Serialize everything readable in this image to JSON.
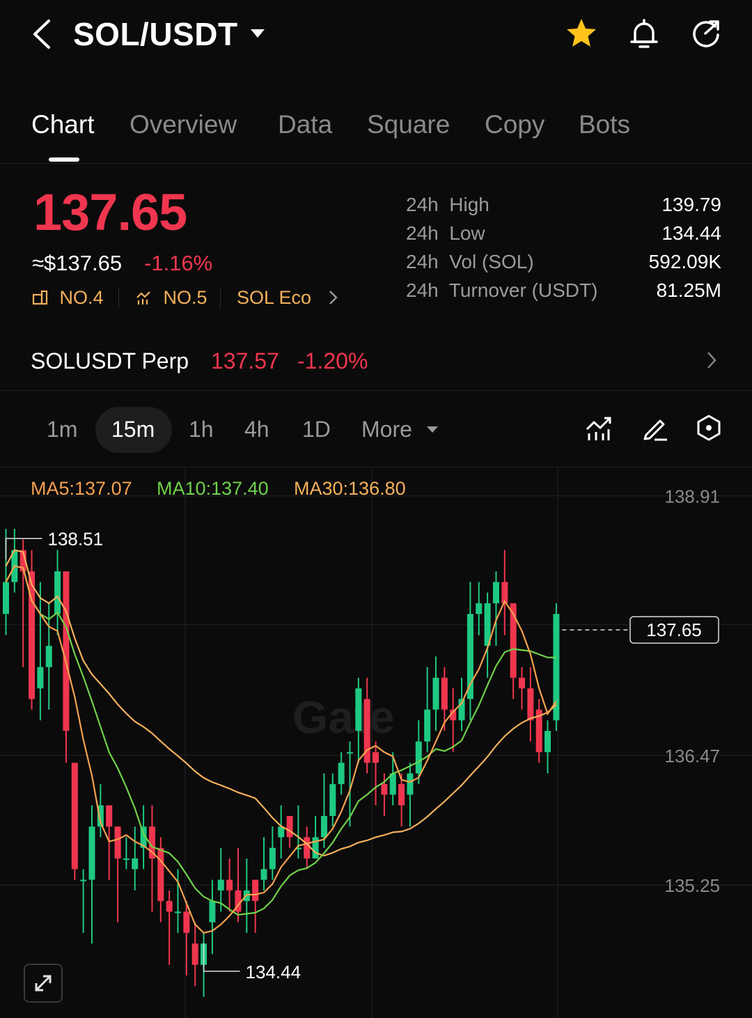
{
  "header": {
    "title": "SOL/USDT",
    "icons": [
      "back-chevron-icon",
      "dropdown-caret-icon",
      "star-icon",
      "bell-icon",
      "share-icon"
    ],
    "star_color": "#ffc31a"
  },
  "tabs": [
    {
      "label": "Chart",
      "active": true
    },
    {
      "label": "Overview"
    },
    {
      "label": "Data"
    },
    {
      "label": "Square"
    },
    {
      "label": "Copy"
    },
    {
      "label": "Bots"
    }
  ],
  "ticker": {
    "last_price": "137.65",
    "fiat_price": "≈$137.65",
    "change_pct": "-1.16%",
    "rank1": "NO.4",
    "rank2": "NO.5",
    "eco": "SOL Eco",
    "stats": [
      {
        "period": "24h",
        "label": "High",
        "value": "139.79"
      },
      {
        "period": "24h",
        "label": "Low",
        "value": "134.44"
      },
      {
        "period": "24h",
        "label": "Vol (SOL)",
        "value": "592.09K"
      },
      {
        "period": "24h",
        "label": "Turnover (USDT)",
        "value": "81.25M"
      }
    ]
  },
  "perp": {
    "name": "SOLUSDT Perp",
    "price": "137.57",
    "change": "-1.20%"
  },
  "intervals": [
    {
      "label": "1m"
    },
    {
      "label": "15m",
      "active": true
    },
    {
      "label": "1h"
    },
    {
      "label": "4h"
    },
    {
      "label": "1D"
    },
    {
      "label": "More"
    }
  ],
  "tools": [
    "indicator-icon",
    "draw-pen-icon",
    "settings-hex-icon"
  ],
  "colors": {
    "up": "#1ec982",
    "down": "#f0364f",
    "ma5": "#f6a14f",
    "ma10": "#6fd24a",
    "ma30": "#f6b15c",
    "accent": "#f6b15c"
  },
  "chart_data": {
    "type": "candlestick",
    "interval": "15m",
    "ma_labels": {
      "ma5": "MA5:137.07",
      "ma10": "MA10:137.40",
      "ma30": "MA30:136.80"
    },
    "y_ticks": [
      "138.91",
      "136.47",
      "135.25"
    ],
    "high_marker": "138.51",
    "low_marker": "134.44",
    "current_price_label": "137.65",
    "ylim": [
      134.0,
      139.17
    ],
    "candles": [
      [
        137.8,
        138.1,
        138.6,
        137.6
      ],
      [
        138.1,
        138.4,
        138.6,
        138.0
      ],
      [
        138.4,
        138.2,
        138.5,
        137.3
      ],
      [
        138.2,
        137.0,
        138.4,
        136.9
      ],
      [
        137.1,
        137.3,
        138.1,
        136.8
      ],
      [
        137.3,
        137.5,
        137.9,
        136.9
      ],
      [
        137.8,
        138.2,
        138.4,
        137.6
      ],
      [
        138.2,
        136.7,
        138.0,
        136.4
      ],
      [
        136.4,
        135.4,
        136.4,
        135.3
      ],
      [
        135.3,
        135.3,
        135.4,
        134.8
      ],
      [
        135.3,
        135.8,
        136.0,
        134.7
      ],
      [
        135.8,
        136.0,
        136.2,
        135.7
      ],
      [
        136.0,
        135.8,
        136.0,
        135.3
      ],
      [
        135.8,
        135.5,
        135.8,
        134.9
      ],
      [
        135.5,
        135.5,
        135.7,
        135.4
      ],
      [
        135.4,
        135.5,
        135.8,
        135.2
      ],
      [
        135.6,
        135.8,
        136.0,
        135.4
      ],
      [
        135.8,
        135.5,
        136.0,
        135.0
      ],
      [
        135.6,
        135.1,
        135.7,
        134.9
      ],
      [
        135.1,
        135.0,
        135.2,
        134.5
      ],
      [
        135.0,
        135.0,
        135.4,
        134.8
      ],
      [
        135.0,
        134.8,
        135.1,
        134.4
      ],
      [
        134.7,
        134.5,
        134.9,
        134.3
      ],
      [
        134.5,
        134.7,
        134.8,
        134.2
      ],
      [
        134.9,
        135.1,
        135.3,
        134.6
      ],
      [
        135.2,
        135.3,
        135.6,
        135.0
      ],
      [
        135.3,
        135.2,
        135.5,
        135.0
      ],
      [
        135.2,
        135.0,
        135.6,
        134.9
      ],
      [
        135.1,
        135.2,
        135.5,
        134.8
      ],
      [
        135.3,
        135.1,
        135.3,
        134.8
      ],
      [
        135.3,
        135.4,
        135.7,
        135.2
      ],
      [
        135.4,
        135.6,
        135.8,
        135.3
      ],
      [
        135.7,
        135.8,
        136.0,
        135.5
      ],
      [
        135.9,
        135.7,
        135.9,
        135.6
      ],
      [
        135.6,
        135.6,
        136.0,
        135.5
      ],
      [
        135.7,
        135.5,
        135.8,
        135.4
      ],
      [
        135.5,
        135.7,
        135.9,
        135.6
      ],
      [
        135.7,
        135.9,
        136.3,
        135.6
      ],
      [
        135.9,
        136.2,
        136.3,
        135.8
      ],
      [
        136.2,
        136.4,
        136.5,
        136.1
      ],
      [
        136.5,
        136.5,
        136.6,
        135.8
      ],
      [
        136.7,
        137.1,
        137.2,
        136.4
      ],
      [
        137.0,
        136.4,
        137.2,
        136.3
      ],
      [
        136.5,
        136.4,
        136.6,
        136.0
      ],
      [
        136.2,
        136.1,
        136.3,
        135.9
      ],
      [
        136.1,
        136.3,
        136.5,
        136.0
      ],
      [
        136.2,
        136.0,
        136.3,
        135.8
      ],
      [
        136.1,
        136.3,
        136.4,
        135.8
      ],
      [
        136.3,
        136.6,
        136.8,
        136.2
      ],
      [
        136.6,
        136.9,
        137.3,
        136.5
      ],
      [
        136.9,
        137.2,
        137.4,
        136.7
      ],
      [
        137.2,
        136.9,
        137.3,
        136.7
      ],
      [
        136.9,
        136.8,
        137.1,
        136.5
      ],
      [
        136.8,
        137.0,
        137.2,
        136.7
      ],
      [
        137.0,
        137.8,
        138.1,
        136.8
      ],
      [
        137.8,
        137.9,
        138.1,
        137.6
      ],
      [
        137.5,
        137.9,
        138.0,
        137.2
      ],
      [
        137.9,
        138.1,
        138.2,
        137.5
      ],
      [
        138.1,
        137.9,
        138.4,
        137.6
      ],
      [
        137.9,
        137.2,
        137.9,
        137.0
      ],
      [
        137.2,
        137.1,
        137.3,
        136.9
      ],
      [
        137.1,
        136.8,
        137.3,
        136.6
      ],
      [
        136.9,
        136.5,
        137.0,
        136.4
      ],
      [
        136.5,
        136.7,
        136.8,
        136.3
      ],
      [
        136.8,
        137.8,
        137.9,
        136.7
      ]
    ]
  }
}
